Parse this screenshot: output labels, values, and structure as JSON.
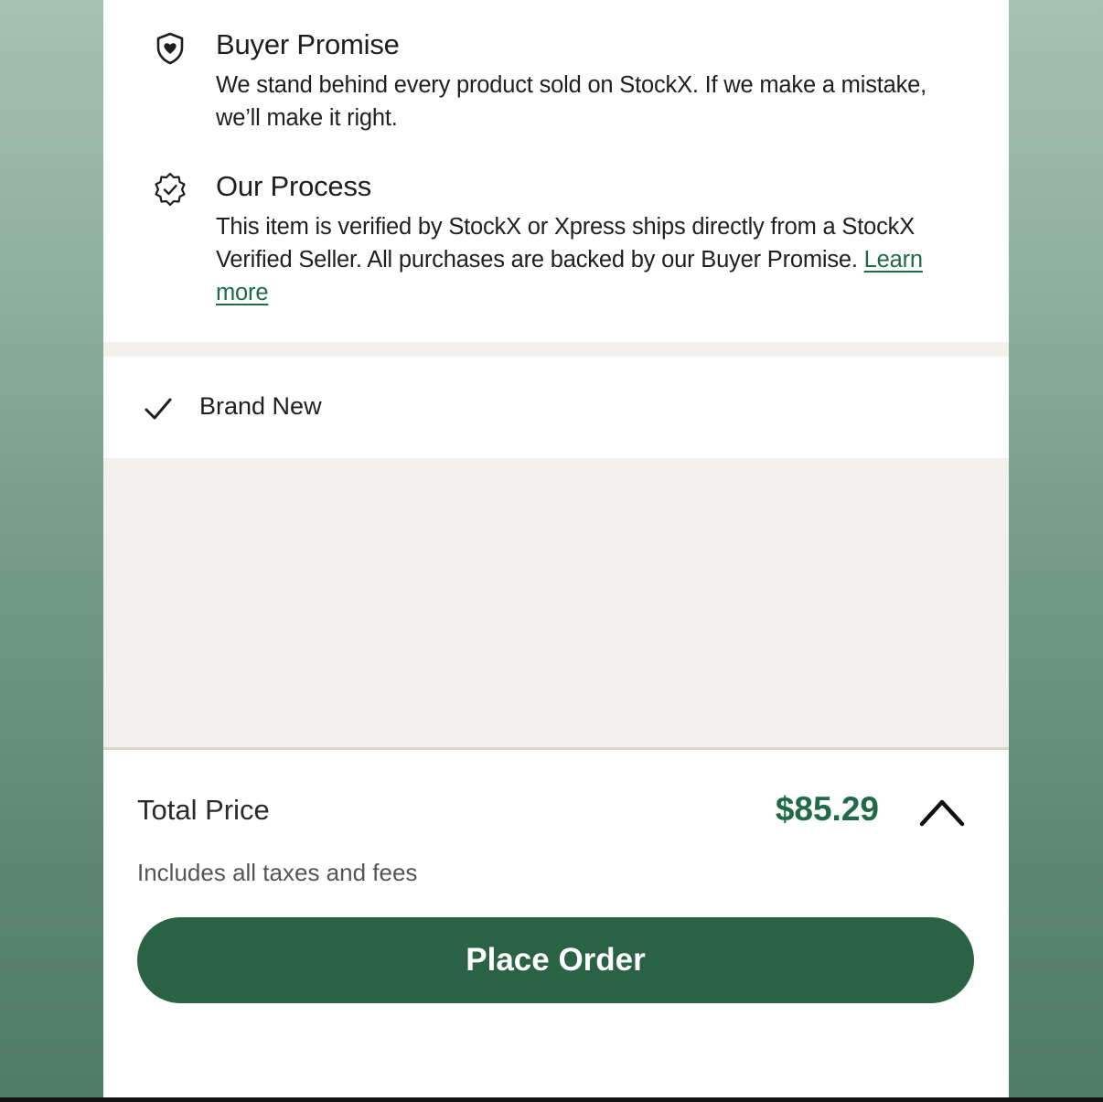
{
  "buyer_promise": {
    "icon": "shield-heart-icon",
    "title": "Buyer Promise",
    "body": "We stand behind every product sold on StockX. If we make a mistake, we’ll make it right."
  },
  "our_process": {
    "icon": "verified-badge-icon",
    "title": "Our Process",
    "body": "This item is verified by StockX or Xpress ships directly from a StockX Verified Seller. All purchases are backed by our Buyer Promise.",
    "link_label": "Learn more"
  },
  "condition": {
    "icon": "checkmark-icon",
    "label": "Brand New"
  },
  "total": {
    "label": "Total Price",
    "price": "$85.29",
    "note": "Includes all taxes and fees",
    "toggle_icon": "chevron-up-icon"
  },
  "cta": {
    "label": "Place Order"
  },
  "colors": {
    "brand_green": "#2a6244",
    "price_green": "#1f6a47",
    "backdrop_top": "#a7c0b2",
    "backdrop_bottom": "#4f7c65"
  }
}
